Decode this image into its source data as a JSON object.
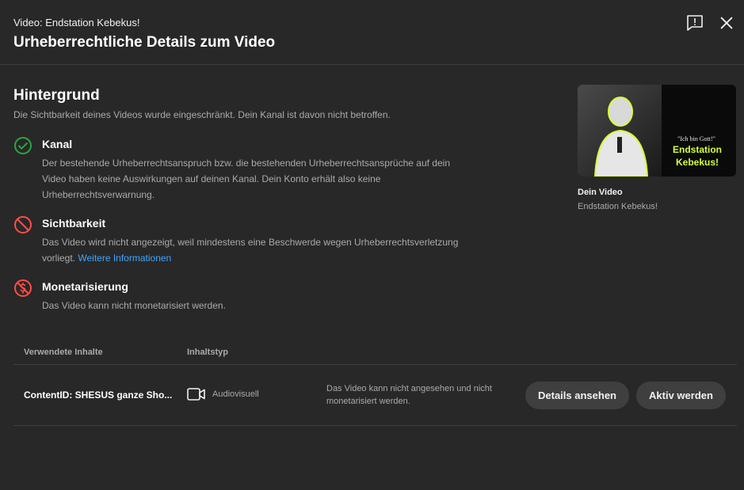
{
  "header": {
    "subtitle": "Video: Endstation Kebekus!",
    "title": "Urheberrechtliche Details zum Video",
    "feedback_icon": "feedback-icon",
    "close_icon": "close-icon"
  },
  "background": {
    "title": "Hintergrund",
    "description": "Die Sichtbarkeit deines Videos wurde eingeschränkt. Dein Kanal ist davon nicht betroffen."
  },
  "items": [
    {
      "icon": "check-circle-icon",
      "color": "#2ba640",
      "heading": "Kanal",
      "text": "Der bestehende Urheberrechtsanspruch bzw. die bestehenden Urheberrechtsansprüche auf dein Video haben keine Auswirkungen auf deinen Kanal. Dein Konto erhält also keine Urheberrechtsverwarnung."
    },
    {
      "icon": "blocked-icon",
      "color": "#ff4e45",
      "heading": "Sichtbarkeit",
      "text": "Das Video wird nicht angezeigt, weil mindestens eine Beschwerde wegen Urheberrechtsverletzung vorliegt.",
      "link": "Weitere Informationen"
    },
    {
      "icon": "demonetized-icon",
      "color": "#ff4e45",
      "heading": "Monetarisierung",
      "text": "Das Video kann nicht monetarisiert werden."
    }
  ],
  "video": {
    "thumbnail_quote": "\"Ich bin Gott!\"",
    "thumbnail_title_1": "Endstation",
    "thumbnail_title_2": "Kebekus!",
    "label": "Dein Video",
    "name": "Endstation Kebekus!"
  },
  "table": {
    "headers": [
      "Verwendete Inhalte",
      "Inhaltstyp"
    ],
    "rows": [
      {
        "content": "ContentID: SHESUS ganze Sho...",
        "type_icon": "video-camera-icon",
        "type": "Audiovisuell",
        "status": "Das Video kann nicht angesehen und nicht monetarisiert werden.",
        "details_label": "Details ansehen",
        "action_label": "Aktiv werden"
      }
    ]
  },
  "colors": {
    "background": "#282828",
    "accent_link": "#3ea6ff",
    "success": "#2ba640",
    "error": "#ff4e45",
    "thumbnail_text": "#d6ff3a"
  }
}
